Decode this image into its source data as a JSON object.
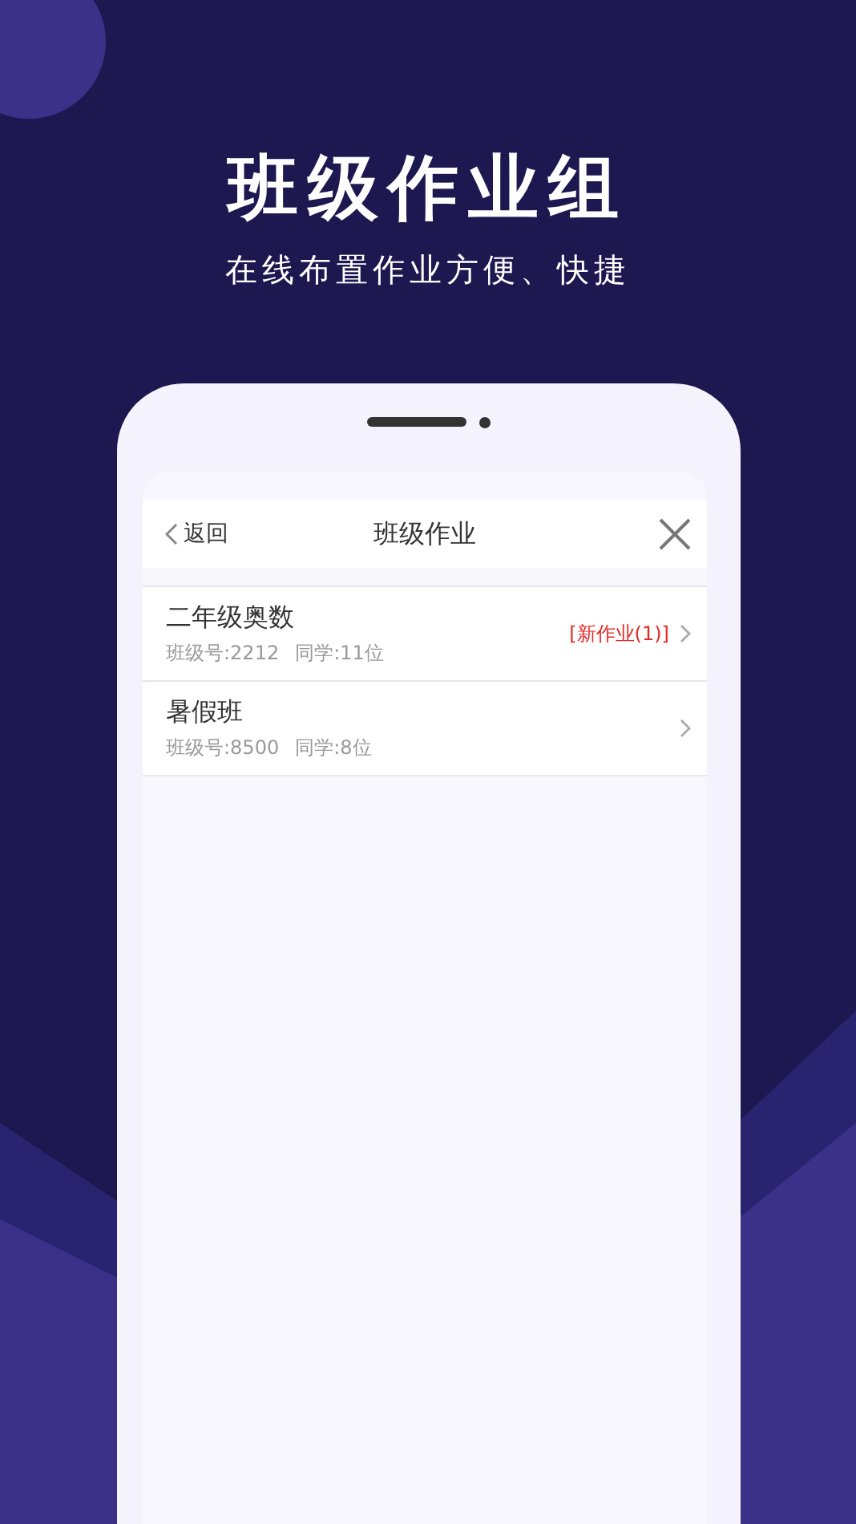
{
  "headline": "班级作业组",
  "subtitle": "在线布置作业方便、快捷",
  "app": {
    "back_label": "返回",
    "title": "班级作业",
    "classes": [
      {
        "name": "二年级奥数",
        "class_no": "班级号:2212",
        "students": "同学:11位",
        "badge": "[新作业(1)]"
      },
      {
        "name": "暑假班",
        "class_no": "班级号:8500",
        "students": "同学:8位"
      }
    ]
  }
}
